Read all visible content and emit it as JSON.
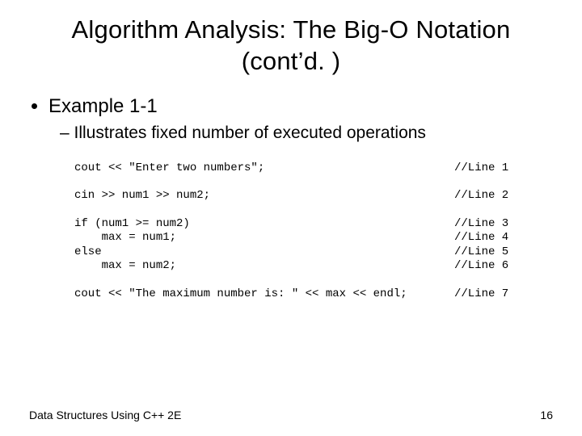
{
  "title": {
    "line1": "Algorithm Analysis: The Big-O Notation",
    "line2": "(cont’d. )"
  },
  "bullets": {
    "example": "Example 1-1",
    "illustrates": "Illustrates fixed number of executed operations"
  },
  "code": [
    {
      "left": "cout << \"Enter two numbers\";",
      "right": "//Line 1"
    },
    {
      "left": "cin >> num1 >> num2;",
      "right": "//Line 2"
    },
    {
      "left": "if (num1 >= num2)",
      "right": "//Line 3"
    },
    {
      "left": "    max = num1;",
      "right": "//Line 4"
    },
    {
      "left": "else",
      "right": "//Line 5"
    },
    {
      "left": "    max = num2;",
      "right": "//Line 6"
    },
    {
      "left": "cout << \"The maximum number is: \" << max << endl;",
      "right": "//Line 7"
    }
  ],
  "footer": {
    "text": "Data Structures Using C++ 2E",
    "page": "16"
  }
}
